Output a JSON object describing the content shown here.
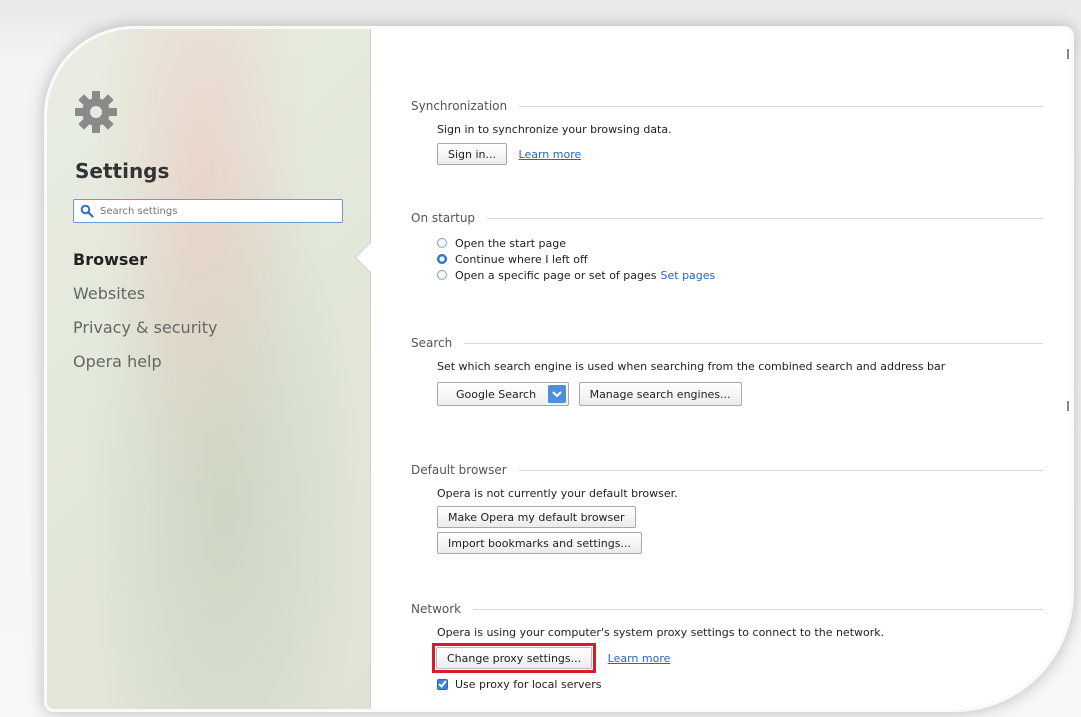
{
  "sidebar": {
    "title": "Settings",
    "search_placeholder": "Search settings",
    "items": [
      {
        "label": "Browser",
        "active": true
      },
      {
        "label": "Websites",
        "active": false
      },
      {
        "label": "Privacy & security",
        "active": false
      },
      {
        "label": "Opera help",
        "active": false
      }
    ]
  },
  "sync": {
    "header": "Synchronization",
    "description": "Sign in to synchronize your browsing data.",
    "sign_in_button": "Sign in...",
    "learn_more": "Learn more"
  },
  "startup": {
    "header": "On startup",
    "options": [
      {
        "label": "Open the start page",
        "checked": false
      },
      {
        "label": "Continue where I left off",
        "checked": true
      },
      {
        "label": "Open a specific page or set of pages",
        "checked": false
      }
    ],
    "set_pages_link": "Set pages"
  },
  "search": {
    "header": "Search",
    "description": "Set which search engine is used when searching from the combined search and address bar",
    "engine_selected": "Google Search",
    "manage_button": "Manage search engines..."
  },
  "default_browser": {
    "header": "Default browser",
    "description": "Opera is not currently your default browser.",
    "make_default_button": "Make Opera my default browser",
    "import_button": "Import bookmarks and settings..."
  },
  "network": {
    "header": "Network",
    "description": "Opera is using your computer's system proxy settings to connect to the network.",
    "change_proxy_button": "Change proxy settings...",
    "learn_more": "Learn more",
    "use_proxy_label": "Use proxy for local servers",
    "use_proxy_checked": true
  },
  "colors": {
    "link": "#2a62c8",
    "highlight": "#d21f2a",
    "radio_checked": "#2f7fd8"
  }
}
